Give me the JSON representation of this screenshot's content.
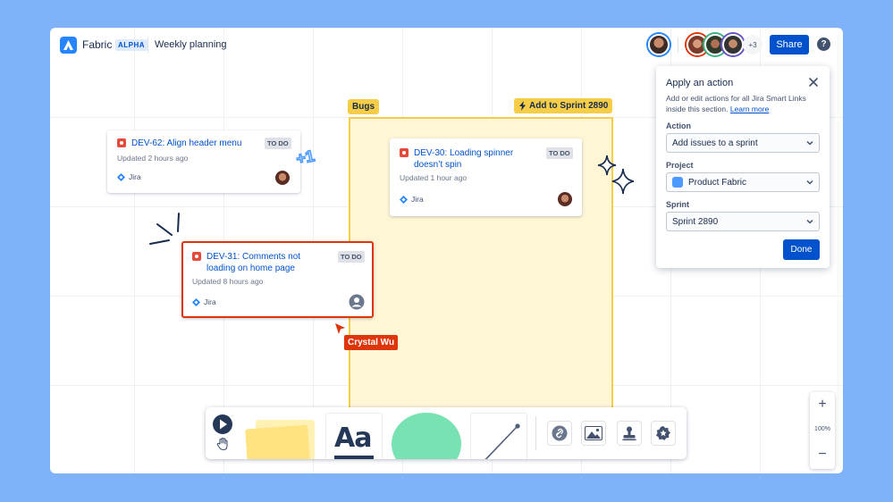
{
  "header": {
    "app_name": "Fabric",
    "badge": "ALPHA",
    "board_title": "Weekly planning",
    "avatar_overflow": "+3",
    "share_label": "Share",
    "help_label": "?"
  },
  "section": {
    "label": "Bugs",
    "action_tag": "Add to Sprint 2890"
  },
  "cards": [
    {
      "title": "DEV-62: Align header menu",
      "status": "TO DO",
      "updated": "Updated 2 hours ago",
      "source": "Jira"
    },
    {
      "title": "DEV-30: Loading spinner doesn’t spin",
      "status": "TO DO",
      "updated": "Updated 1 hour ago",
      "source": "Jira"
    },
    {
      "title": "DEV-31: Comments not loading on home page",
      "status": "TO DO",
      "updated": "Updated 8 hours ago",
      "source": "Jira"
    }
  ],
  "reaction": "+1",
  "cursor": {
    "name": "Crystal Wu"
  },
  "panel": {
    "title": "Apply an action",
    "description": "Add or edit actions for all Jira Smart Links inside this section.",
    "learn_more": "Learn more",
    "action_label": "Action",
    "action_value": "Add issues to a sprint",
    "project_label": "Project",
    "project_value": "Product Fabric",
    "sprint_label": "Sprint",
    "sprint_value": "Sprint 2890",
    "done_label": "Done"
  },
  "zoom": {
    "in": "+",
    "level": "100%",
    "out": "−"
  },
  "toolbar": {
    "text_tool": "Aa"
  },
  "colors": {
    "accent": "#0052cc",
    "section_bg": "#fff6d6",
    "section_border": "#f5cd47",
    "bug": "#e5493a",
    "cursor": "#de350b",
    "page_bg": "#7fb2f8"
  }
}
